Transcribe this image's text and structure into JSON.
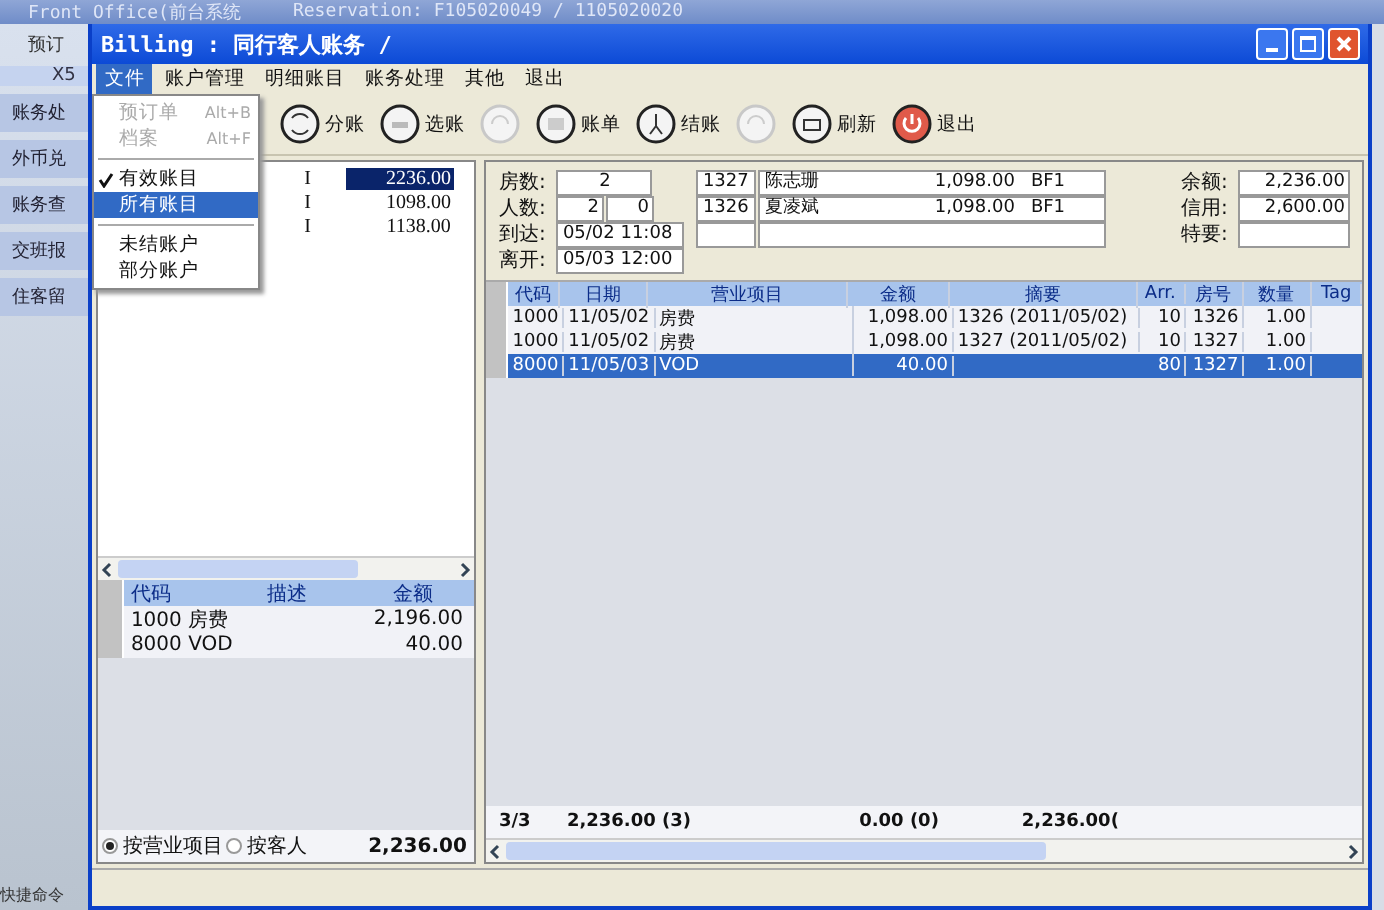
{
  "background_app": {
    "title": "Front Office(前台系统",
    "reservation_title": "Reservation: F105020049 / 1105020020",
    "tab": "预订",
    "logo": "X5",
    "sidebar_items": [
      "账务处",
      "外币兑",
      "账务查",
      "交班报",
      "住客留"
    ],
    "footer": "快捷命令"
  },
  "window": {
    "title": "Billing : 同行客人账务 /"
  },
  "menu": [
    {
      "label": "文件",
      "selected": true
    },
    {
      "label": "账户管理",
      "selected": false
    },
    {
      "label": "明细账目",
      "selected": false
    },
    {
      "label": "账务处理",
      "selected": false
    },
    {
      "label": "其他",
      "selected": false
    },
    {
      "label": "退出",
      "selected": false
    }
  ],
  "file_menu": [
    {
      "kind": "item",
      "label": "预订单",
      "shortcut": "Alt+B",
      "disabled": true,
      "checked": false,
      "selected": false
    },
    {
      "kind": "item",
      "label": "档案",
      "shortcut": "Alt+F",
      "disabled": true,
      "checked": false,
      "selected": false
    },
    {
      "kind": "separator"
    },
    {
      "kind": "item",
      "label": "有效账目",
      "disabled": false,
      "checked": true,
      "selected": false
    },
    {
      "kind": "item",
      "label": "所有账目",
      "disabled": false,
      "checked": false,
      "selected": true
    },
    {
      "kind": "separator"
    },
    {
      "kind": "item",
      "label": "未结账户",
      "disabled": false,
      "checked": false,
      "selected": false
    },
    {
      "kind": "item",
      "label": "部分账户",
      "disabled": false,
      "checked": false,
      "selected": false
    }
  ],
  "toolbar": [
    {
      "kind": "split",
      "label": "分账",
      "disabled": false
    },
    {
      "kind": "select",
      "label": "选账",
      "disabled": false
    },
    {
      "kind": "swap",
      "disabled": true
    },
    {
      "kind": "bill",
      "label": "账单",
      "disabled": false
    },
    {
      "kind": "checkout",
      "label": "结账",
      "disabled": false
    },
    {
      "kind": "swap",
      "disabled": true
    },
    {
      "kind": "refresh",
      "label": "刷新",
      "disabled": false
    },
    {
      "kind": "exit",
      "label": "退出",
      "disabled": false
    }
  ],
  "accounts": [
    {
      "type": "I",
      "amount": "2236.00",
      "selected": true
    },
    {
      "type": "I",
      "amount": "1098.00",
      "selected": false
    },
    {
      "type": "I",
      "amount": "1138.00",
      "selected": false
    }
  ],
  "summary": {
    "columns": [
      "代码",
      "描述",
      "金额"
    ],
    "rows": [
      {
        "code": "1000",
        "description": "房费",
        "amount": "2,196.00"
      },
      {
        "code": "8000",
        "description": "VOD",
        "amount": "40.00"
      }
    ]
  },
  "group_by": [
    {
      "label": "按营业项目",
      "selected": true
    },
    {
      "label": "按客人",
      "selected": false
    }
  ],
  "total": "2,236.00",
  "stay": {
    "rooms_label": "房数:",
    "rooms": "2",
    "guests_label": "人数:",
    "adults": "2",
    "children": "0",
    "arrival_label": "到达:",
    "arrival": "05/02 11:08",
    "departure_label": "离开:",
    "departure": "05/03 12:00"
  },
  "guests": [
    {
      "room": "1327",
      "name": "陈志珊",
      "rate": "1,098.00",
      "package": "BF1"
    },
    {
      "room": "1326",
      "name": "夏凌斌",
      "rate": "1,098.00",
      "package": "BF1"
    }
  ],
  "balance": [
    {
      "label": "余额:",
      "value": "2,236.00"
    },
    {
      "label": "信用:",
      "value": "2,600.00"
    },
    {
      "label": "特要:"
    }
  ],
  "postings": {
    "columns": [
      "代码",
      "日期",
      "营业项目",
      "金额",
      "摘要",
      "Arr.",
      "房号",
      "数量",
      "Tag"
    ],
    "rows": [
      {
        "cells": [
          "1000",
          "11/05/02",
          "房费",
          "1,098.00",
          "1326 (2011/05/02)",
          "10",
          "1326",
          "1.00",
          ""
        ],
        "selected": false
      },
      {
        "cells": [
          "1000",
          "11/05/02",
          "房费",
          "1,098.00",
          "1327 (2011/05/02)",
          "10",
          "1327",
          "1.00",
          ""
        ],
        "selected": false
      },
      {
        "cells": [
          "8000",
          "11/05/03",
          "VOD",
          "40.00",
          "",
          "80",
          "1327",
          "1.00",
          ""
        ],
        "selected": true
      }
    ]
  },
  "footer": [
    "3/3",
    "2,236.00 (3)",
    "0.00 (0)",
    "2,236.00("
  ]
}
